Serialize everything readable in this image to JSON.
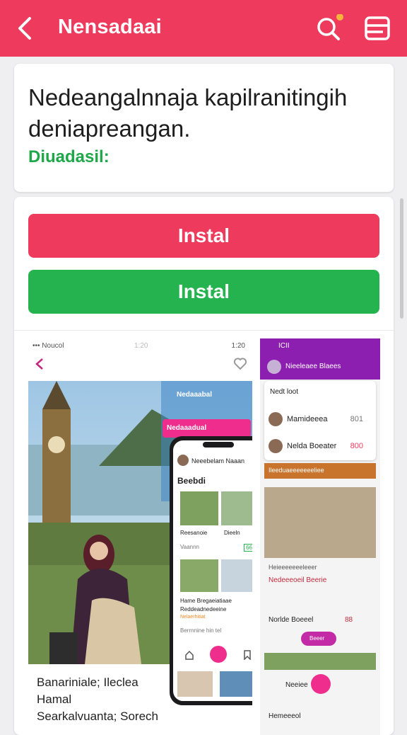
{
  "appbar": {
    "title": "Nensadaai",
    "back_icon": "chevron-left-icon",
    "search_icon": "search-icon",
    "menu_icon": "list-menu-icon",
    "color": "#ee3a5c"
  },
  "info": {
    "description": "Nedeangalnnaja kapilranitingih deniapreangan.",
    "status": "Diuadasil:"
  },
  "actions": {
    "install_red": "Instal",
    "install_green": "Instal",
    "red": "#ee3a5c",
    "green": "#24b34e"
  },
  "screenshot1": {
    "status_left": "••• Noucol",
    "status_time": "1:20",
    "status_right": "1:20",
    "badge1": "Nedaaabal",
    "badge2": "Nedaaadual",
    "caption1": "Banariniale; Ileclea",
    "caption2": "Hamal",
    "caption3": "Searkalvuanta; Sorech",
    "phone": {
      "header": "Neeebelam Naaan",
      "section": "Beebdi",
      "item1": "Reesanoie",
      "item2": "Dieeln",
      "item3": "Vaannn",
      "tag": "666",
      "line1": "Hame Bregaeiatiaae",
      "line2": "Reddeadnedeeine",
      "line3": "Nelaerhitiat",
      "line4": "Berrnnine hin tel"
    }
  },
  "screenshot2": {
    "status_left": "ICII",
    "header": "Nieeleaee Blaees",
    "row0": "Nedt loot",
    "row1_name": "Mamideeea",
    "row1_value": "801",
    "row2_name": "Nelda Boeater",
    "row2_value": "800",
    "banner": "Ileeduaeeeeeeeliee",
    "text1": "Heieeeeeeeleeer",
    "text2": "Nedeeeoeil Beerie",
    "row3_name": "Norlde Boeeel",
    "row3_value": "88",
    "pill": "Beeer",
    "row4_name": "Neeiee",
    "bottom": "Hemeeeol"
  }
}
